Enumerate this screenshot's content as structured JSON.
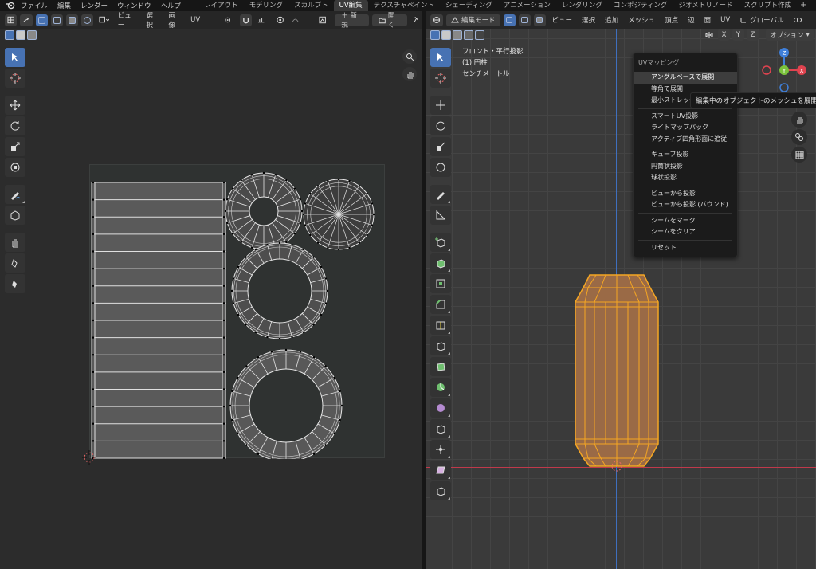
{
  "topbar": {
    "menu": [
      "ファイル",
      "編集",
      "レンダー",
      "ウィンドウ",
      "ヘルプ"
    ],
    "tabs": [
      "レイアウト",
      "モデリング",
      "スカルプト",
      "UV編集",
      "テクスチャペイント",
      "シェーディング",
      "アニメーション",
      "レンダリング",
      "コンポジティング",
      "ジオメトリノード",
      "スクリプト作成"
    ],
    "active_tab": "UV編集",
    "add_tab": "+"
  },
  "uv_editor": {
    "header": {
      "menus": [
        "ビュー",
        "選択",
        "画像",
        "UV"
      ],
      "new_label": "＋ 新規",
      "open_label": "開く"
    }
  },
  "viewport": {
    "header": {
      "mode": "編集モード",
      "menus": [
        "ビュー",
        "選択",
        "追加",
        "メッシュ",
        "頂点",
        "辺",
        "面",
        "UV"
      ],
      "orientation": "グローバル",
      "axes": [
        "X",
        "Y",
        "Z"
      ],
      "options_label": "オプション"
    },
    "info": {
      "view": "フロント・平行投影",
      "object": "(1) 円柱",
      "units": "センチメートル"
    },
    "gizmo": {
      "x": "X",
      "y": "Y",
      "z": "Z"
    }
  },
  "uv_menu": {
    "title": "UVマッピング",
    "items": [
      "アングルベースで展開",
      "等角で展開",
      "最小ストレッチ",
      "スマートUV投影",
      "ライトマップパック",
      "アクティブ四角形面に追従",
      "キューブ投影",
      "円筒状投影",
      "球状投影",
      "ビューから投影",
      "ビューから投影 (バウンド)",
      "シームをマーク",
      "シームをクリア",
      "リセット"
    ],
    "highlighted": "アングルベースで展開"
  },
  "tooltip": "編集中のオブジェクトのメッシュを展開し",
  "colors": {
    "accent": "#4772b3",
    "selected_mesh": "#f5a623",
    "x_axis": "#e0434f",
    "y_axis": "#7bc23c",
    "z_axis": "#3f7fd9"
  }
}
